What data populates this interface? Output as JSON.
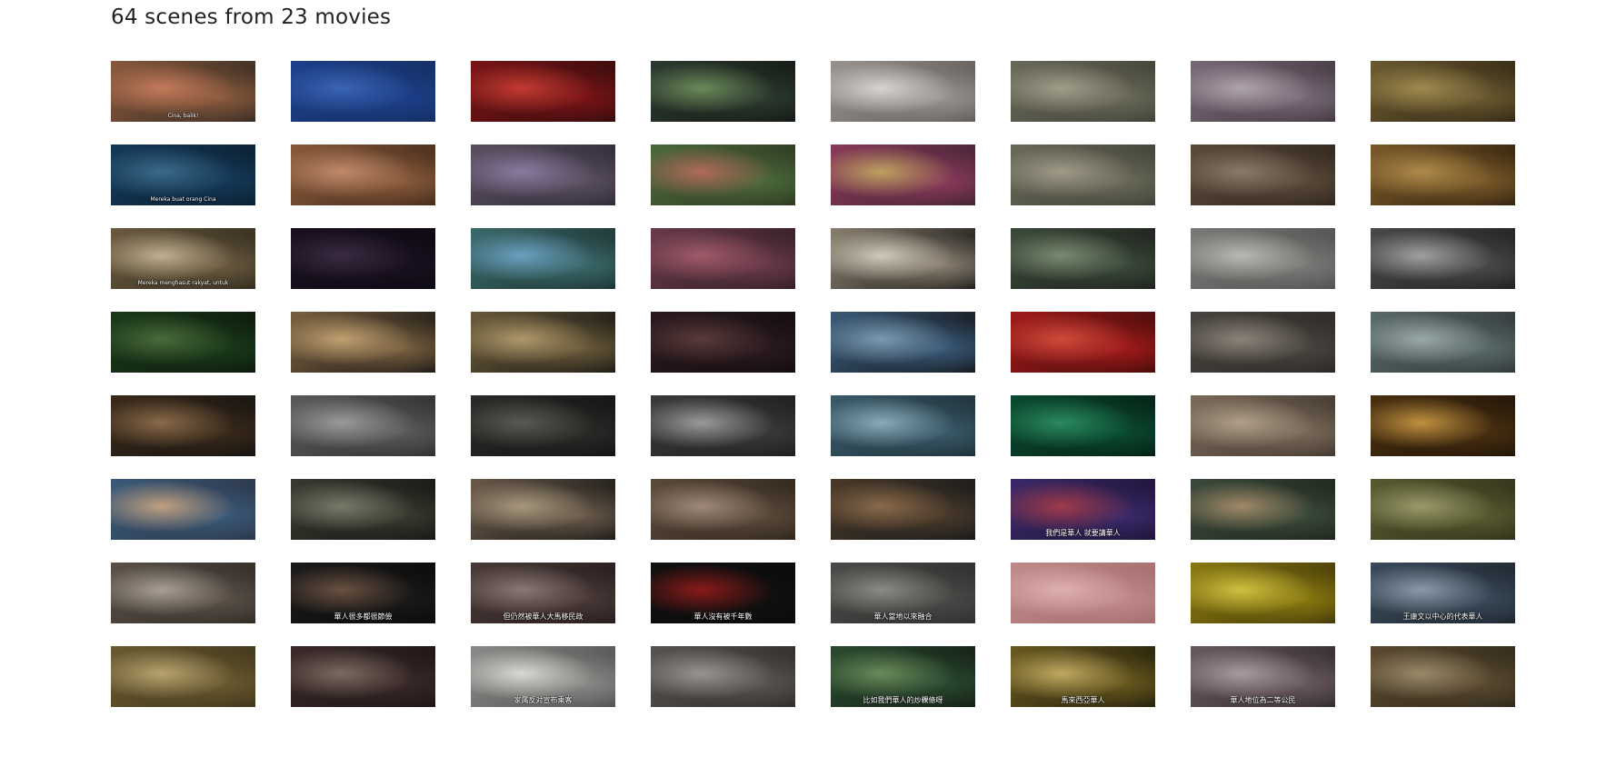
{
  "header": {
    "title": "64 scenes from 23 movies"
  },
  "scenes": [
    {
      "subtitle": "Cina, balik!",
      "colors": [
        "#8a5a3c",
        "#c47a5a",
        "#2a2420"
      ]
    },
    {
      "subtitle": "",
      "colors": [
        "#1c3f8a",
        "#3a64b4",
        "#142c5c"
      ]
    },
    {
      "subtitle": "",
      "colors": [
        "#7a1418",
        "#c23a30",
        "#2a0a0a"
      ]
    },
    {
      "subtitle": "",
      "colors": [
        "#2c3a30",
        "#6a8a5a",
        "#101410"
      ]
    },
    {
      "subtitle": "",
      "colors": [
        "#9a9490",
        "#d8d4d0",
        "#5a5450"
      ]
    },
    {
      "subtitle": "",
      "colors": [
        "#6a6a5a",
        "#a09e8a",
        "#3a3a30"
      ]
    },
    {
      "subtitle": "",
      "colors": [
        "#7a6a78",
        "#b0a4ac",
        "#3a3038"
      ]
    },
    {
      "subtitle": "",
      "colors": [
        "#6a5a30",
        "#a08a50",
        "#2a2010"
      ]
    },
    {
      "subtitle": "Mereka buat orang Cina",
      "colors": [
        "#143a5a",
        "#3a6a8a",
        "#0a1a2a"
      ]
    },
    {
      "subtitle": "",
      "colors": [
        "#8a5a3a",
        "#c08a6a",
        "#3a2418"
      ]
    },
    {
      "subtitle": "",
      "colors": [
        "#5a5060",
        "#8a7aa0",
        "#2a2430"
      ]
    },
    {
      "subtitle": "",
      "colors": [
        "#4a6a3a",
        "#b06a5a",
        "#2a3020"
      ]
    },
    {
      "subtitle": "",
      "colors": [
        "#8a3a5a",
        "#c0a060",
        "#3a2030"
      ]
    },
    {
      "subtitle": "",
      "colors": [
        "#6a6a5a",
        "#a09a88",
        "#3a3a30"
      ]
    },
    {
      "subtitle": "",
      "colors": [
        "#5a4a3a",
        "#8a7a6a",
        "#2a2018"
      ]
    },
    {
      "subtitle": "",
      "colors": [
        "#7a5a2a",
        "#b08a4a",
        "#2a1a0a"
      ]
    },
    {
      "subtitle": "Mereka menghasut rakyat, untuk",
      "colors": [
        "#6a5a40",
        "#c0b090",
        "#2a2418"
      ]
    },
    {
      "subtitle": "",
      "colors": [
        "#1a1020",
        "#3a2a40",
        "#0a0810"
      ]
    },
    {
      "subtitle": "",
      "colors": [
        "#3a6a6a",
        "#6aa0c0",
        "#1a2a2a"
      ]
    },
    {
      "subtitle": "",
      "colors": [
        "#6a3a4a",
        "#a05a6a",
        "#2a1a20"
      ]
    },
    {
      "subtitle": "",
      "colors": [
        "#8a8070",
        "#d0c8b8",
        "#101010"
      ]
    },
    {
      "subtitle": "",
      "colors": [
        "#3a4a3a",
        "#7a8a70",
        "#1a1a18"
      ]
    },
    {
      "subtitle": "",
      "colors": [
        "#7a7a78",
        "#b8b8b4",
        "#4a4a48"
      ]
    },
    {
      "subtitle": "",
      "colors": [
        "#4a4a48",
        "#a0a0a0",
        "#1a1a1a"
      ]
    },
    {
      "subtitle": "",
      "colors": [
        "#1a3a1a",
        "#4a6a3a",
        "#0a140a"
      ]
    },
    {
      "subtitle": "",
      "colors": [
        "#7a6040",
        "#c0a070",
        "#101010"
      ]
    },
    {
      "subtitle": "",
      "colors": [
        "#6a5a3a",
        "#b0986a",
        "#101010"
      ]
    },
    {
      "subtitle": "",
      "colors": [
        "#2a1a20",
        "#5a3a3a",
        "#100a0a"
      ]
    },
    {
      "subtitle": "",
      "colors": [
        "#3a5a7a",
        "#7a9ab0",
        "#101010"
      ]
    },
    {
      "subtitle": "",
      "colors": [
        "#a01a1a",
        "#d04a3a",
        "#3a0a0a"
      ]
    },
    {
      "subtitle": "",
      "colors": [
        "#4a4440",
        "#8a847a",
        "#2a2420"
      ]
    },
    {
      "subtitle": "",
      "colors": [
        "#5a6a6a",
        "#9aaaa8",
        "#2a3030"
      ]
    },
    {
      "subtitle": "",
      "colors": [
        "#3a2a1a",
        "#8a6a4a",
        "#101010"
      ]
    },
    {
      "subtitle": "",
      "colors": [
        "#5a5a5a",
        "#9a9a9a",
        "#2a2a2a"
      ]
    },
    {
      "subtitle": "",
      "colors": [
        "#2a2a28",
        "#5a5a54",
        "#101010"
      ]
    },
    {
      "subtitle": "",
      "colors": [
        "#3a3a3a",
        "#9a9a9a",
        "#1a1a1a"
      ]
    },
    {
      "subtitle": "",
      "colors": [
        "#3a5a6a",
        "#8aaab8",
        "#1a2a30"
      ]
    },
    {
      "subtitle": "",
      "colors": [
        "#0a4a30",
        "#2a8a60",
        "#041a10"
      ]
    },
    {
      "subtitle": "",
      "colors": [
        "#7a6a5a",
        "#b0a08a",
        "#3a3028"
      ]
    },
    {
      "subtitle": "",
      "colors": [
        "#4a3010",
        "#c09040",
        "#1a1008"
      ]
    },
    {
      "subtitle": "",
      "colors": [
        "#3a5a7a",
        "#c0a080",
        "#2a3040"
      ]
    },
    {
      "subtitle": "",
      "colors": [
        "#3a3a30",
        "#7a7a6a",
        "#101010"
      ]
    },
    {
      "subtitle": "",
      "colors": [
        "#6a5a4a",
        "#a8987e",
        "#101010"
      ]
    },
    {
      "subtitle": "",
      "colors": [
        "#5a4a3a",
        "#a08a7a",
        "#2a2018"
      ]
    },
    {
      "subtitle": "",
      "colors": [
        "#4a3a2a",
        "#8a6a4a",
        "#101418"
      ]
    },
    {
      "subtitle": "我們是華人 就要講華人",
      "colors": [
        "#3a2a6a",
        "#a03a4a",
        "#1a1030"
      ]
    },
    {
      "subtitle": "",
      "colors": [
        "#3a4a3a",
        "#a08a6a",
        "#1a2018"
      ]
    },
    {
      "subtitle": "",
      "colors": [
        "#5a5a30",
        "#9a9a6a",
        "#2a2a18"
      ]
    },
    {
      "subtitle": "",
      "colors": [
        "#5a5048",
        "#a89e94",
        "#2a2620"
      ]
    },
    {
      "subtitle": "華人很多都很節儉",
      "colors": [
        "#1a1a1a",
        "#6a5040",
        "#080808"
      ]
    },
    {
      "subtitle": "但仍然被華人大馬移民政",
      "colors": [
        "#4a3a38",
        "#8a7874",
        "#201818"
      ]
    },
    {
      "subtitle": "華人沒有被千年數",
      "colors": [
        "#101010",
        "#8a1a1a",
        "#0a0a0a"
      ]
    },
    {
      "subtitle": "華人當地以來融合",
      "colors": [
        "#4a4a48",
        "#8a8a86",
        "#2a2a28"
      ]
    },
    {
      "subtitle": "",
      "colors": [
        "#c08a8a",
        "#e0b0b0",
        "#a06868"
      ]
    },
    {
      "subtitle": "",
      "colors": [
        "#8a7a10",
        "#d0c040",
        "#3a3008"
      ]
    },
    {
      "subtitle": "王康文以中心的代表華人",
      "colors": [
        "#3a4a5a",
        "#8a9aaa",
        "#1a2028"
      ]
    },
    {
      "subtitle": "",
      "colors": [
        "#6a5a30",
        "#b8a470",
        "#3a3018"
      ]
    },
    {
      "subtitle": "",
      "colors": [
        "#3a2a2a",
        "#7a6a60",
        "#1a1010"
      ]
    },
    {
      "subtitle": "家属反对宣布乘客",
      "colors": [
        "#8a8a88",
        "#d8d8d4",
        "#4a4a48"
      ]
    },
    {
      "subtitle": "",
      "colors": [
        "#5a5450",
        "#9a9490",
        "#2a2624"
      ]
    },
    {
      "subtitle": "比如我們華人的炒粿條呀",
      "colors": [
        "#2a4a30",
        "#6a8a5a",
        "#101810"
      ]
    },
    {
      "subtitle": "馬來西亞華人",
      "colors": [
        "#6a5a20",
        "#c0a860",
        "#1a1808"
      ]
    },
    {
      "subtitle": "華人地位為二等公民",
      "colors": [
        "#6a5a60",
        "#a89aa0",
        "#2a2428"
      ]
    },
    {
      "subtitle": "",
      "colors": [
        "#5a4a30",
        "#9a8a6a",
        "#2a2418"
      ]
    }
  ]
}
